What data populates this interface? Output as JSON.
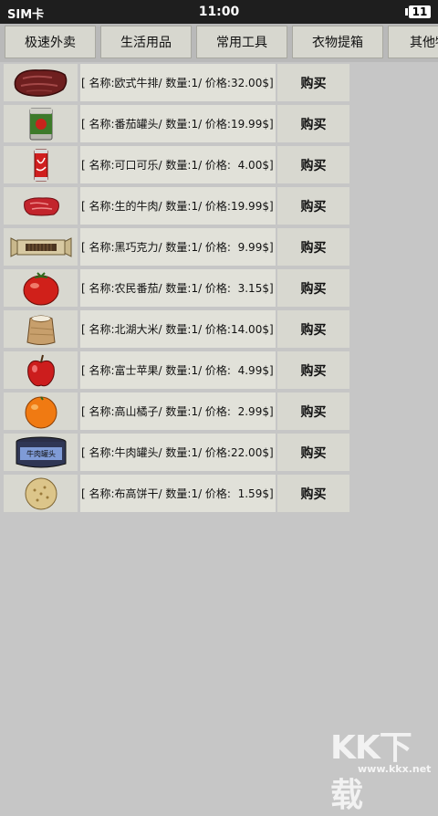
{
  "status_bar": {
    "carrier": "SIM卡",
    "time": "11:00",
    "battery": "11"
  },
  "tabs": [
    {
      "label": "极速外卖"
    },
    {
      "label": "生活用品"
    },
    {
      "label": "常用工具"
    },
    {
      "label": "衣物提箱"
    },
    {
      "label": "其他物"
    }
  ],
  "products": [
    {
      "info": "[ 名称:欧式牛排/ 数量:1/ 价格:32.00$]",
      "buy": "购买",
      "icon": "steak-icon"
    },
    {
      "info": "[ 名称:番茄罐头/ 数量:1/ 价格:19.99$]",
      "buy": "购买",
      "icon": "tomato-can-icon"
    },
    {
      "info": "[ 名称:可口可乐/ 数量:1/ 价格:  4.00$]",
      "buy": "购买",
      "icon": "cola-icon"
    },
    {
      "info": "[ 名称:生的牛肉/ 数量:1/ 价格:19.99$]",
      "buy": "购买",
      "icon": "raw-beef-icon"
    },
    {
      "info": "[ 名称:黑巧克力/ 数量:1/ 价格:  9.99$]",
      "buy": "购买",
      "icon": "chocolate-icon"
    },
    {
      "info": "[ 名称:农民番茄/ 数量:1/ 价格:  3.15$]",
      "buy": "购买",
      "icon": "tomato-icon"
    },
    {
      "info": "[ 名称:北湖大米/ 数量:1/ 价格:14.00$]",
      "buy": "购买",
      "icon": "rice-sack-icon"
    },
    {
      "info": "[ 名称:富士苹果/ 数量:1/ 价格:  4.99$]",
      "buy": "购买",
      "icon": "apple-icon"
    },
    {
      "info": "[ 名称:高山橘子/ 数量:1/ 价格:  2.99$]",
      "buy": "购买",
      "icon": "orange-icon"
    },
    {
      "info": "[ 名称:牛肉罐头/ 数量:1/ 价格:22.00$]",
      "buy": "购买",
      "icon": "beef-can-icon",
      "label": "牛肉罐头"
    },
    {
      "info": "[ 名称:布高饼干/ 数量:1/ 价格:  1.59$]",
      "buy": "购买",
      "icon": "biscuit-icon"
    }
  ],
  "watermark": {
    "text": "KK下载",
    "url": "www.kkx.net"
  }
}
